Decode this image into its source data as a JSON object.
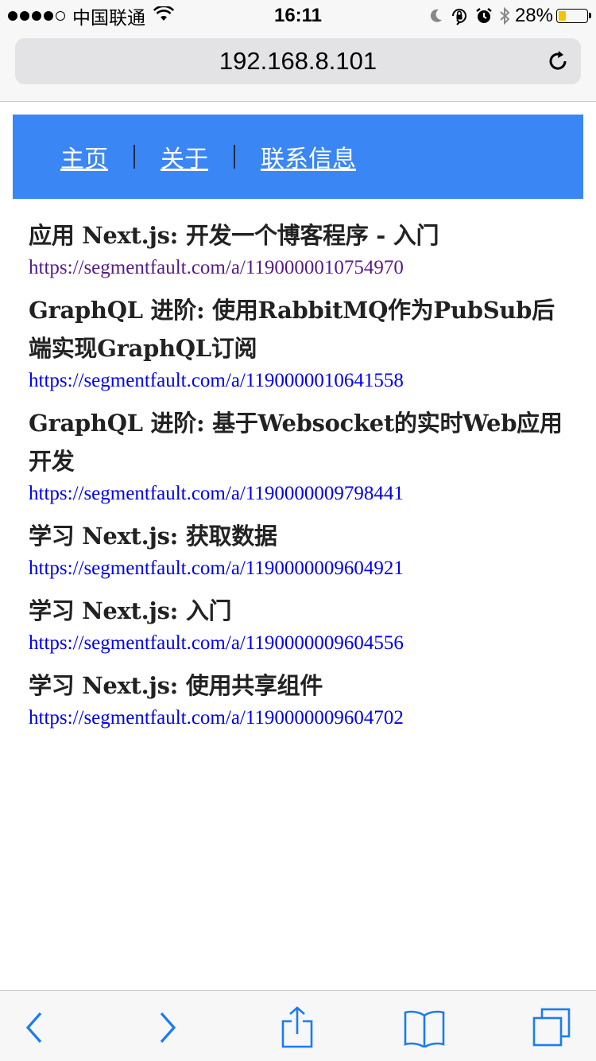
{
  "status_bar": {
    "carrier": "中国联通",
    "time": "16:11",
    "battery_percent": "28%",
    "battery_level": 0.28,
    "signal_dots_filled": 4,
    "signal_dots_total": 5
  },
  "browser": {
    "url": "192.168.8.101"
  },
  "nav": {
    "items": [
      {
        "label": "主页"
      },
      {
        "label": "关于"
      },
      {
        "label": "联系信息"
      }
    ]
  },
  "posts": [
    {
      "title": "应用 Next.js: 开发一个博客程序 - 入门",
      "link": "https://segmentfault.com/a/1190000010754970",
      "visited": true
    },
    {
      "title": "GraphQL 进阶: 使用RabbitMQ作为PubSub后端实现GraphQL订阅",
      "link": "https://segmentfault.com/a/1190000010641558",
      "visited": false
    },
    {
      "title": "GraphQL 进阶: 基于Websocket的实时Web应用开发",
      "link": "https://segmentfault.com/a/1190000009798441",
      "visited": false
    },
    {
      "title": "学习 Next.js: 获取数据",
      "link": "https://segmentfault.com/a/1190000009604921",
      "visited": false
    },
    {
      "title": "学习 Next.js: 入门",
      "link": "https://segmentfault.com/a/1190000009604556",
      "visited": false
    },
    {
      "title": "学习 Next.js: 使用共享组件",
      "link": "https://segmentfault.com/a/1190000009604702",
      "visited": false
    }
  ],
  "colors": {
    "nav_background": "#3b86f5",
    "link": "#0000ee",
    "visited_link": "#551a8b",
    "ios_blue": "#1a7cf5",
    "battery_fill": "#f6c400"
  },
  "icons": {
    "toolbar": [
      "back-icon",
      "forward-icon",
      "share-icon",
      "bookmarks-icon",
      "tabs-icon"
    ],
    "status": [
      "wifi-icon",
      "moon-icon",
      "rotation-lock-icon",
      "alarm-icon",
      "bluetooth-icon",
      "battery-icon"
    ],
    "url": [
      "reload-icon"
    ]
  }
}
